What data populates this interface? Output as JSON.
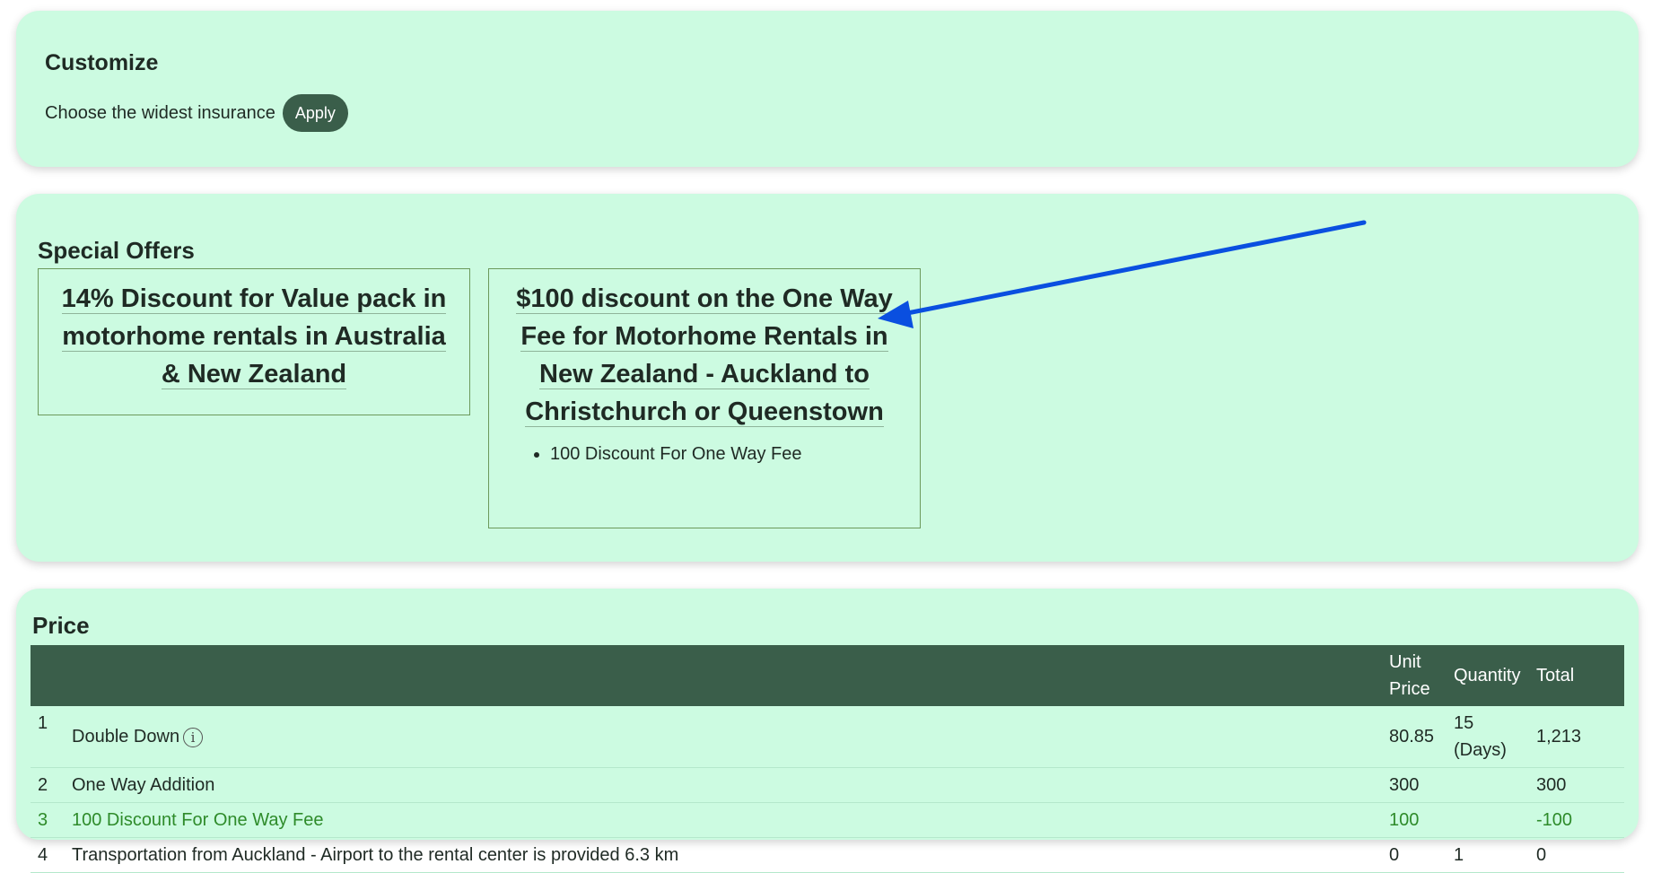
{
  "customize": {
    "title": "Customize",
    "insurance_label": "Choose the widest insurance",
    "apply_label": "Apply"
  },
  "offers": {
    "title": "Special Offers",
    "items": [
      {
        "title": "14% Discount for Value pack in motorhome rentals in Australia & New Zealand",
        "bullets": []
      },
      {
        "title": "$100 discount on the One Way Fee for Motorhome Rentals in New Zealand - Auckland to Christchurch or Queenstown",
        "bullets": [
          "100 Discount For One Way Fee"
        ]
      }
    ]
  },
  "price": {
    "title": "Price",
    "columns": {
      "unit_price": "Unit Price",
      "quantity": "Quantity",
      "total": "Total"
    },
    "rows": [
      {
        "num": "1",
        "name": "Double Down",
        "info_icon": "info-icon",
        "unit_price": "80.85",
        "quantity": "15 (Days)",
        "total": "1,213"
      },
      {
        "num": "2",
        "name": "One Way Addition",
        "unit_price": "300",
        "quantity": "",
        "total": "300"
      },
      {
        "num": "3",
        "name": "100 Discount For One Way Fee",
        "unit_price": "100",
        "quantity": "",
        "total": "-100"
      },
      {
        "num": "4",
        "name": "Transportation from Auckland - Airport to the rental center is provided 6.3 km",
        "unit_price": "0",
        "quantity": "1",
        "total": "0"
      }
    ]
  },
  "colors": {
    "card_background": "#ccfbe1",
    "header_dark_green": "#3a5e4a",
    "discount_green": "#2e8b2a",
    "annotation_arrow": "#0a4fe0"
  }
}
